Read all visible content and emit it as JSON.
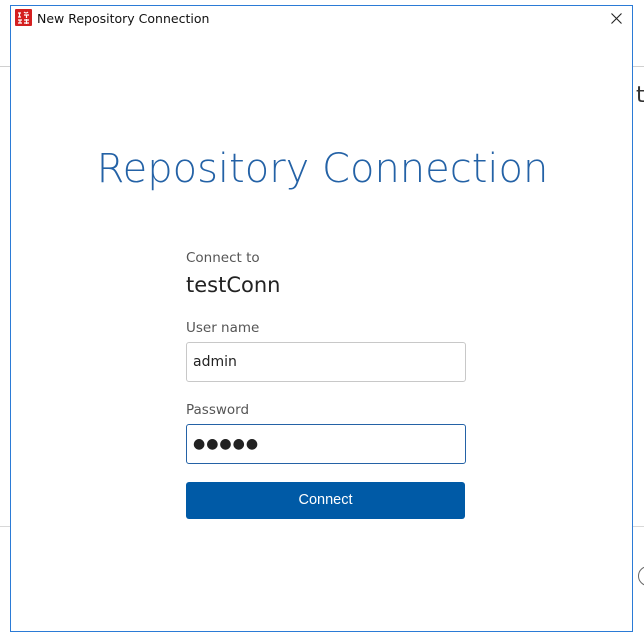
{
  "window": {
    "title": "New Repository Connection",
    "accent_color": "#2b7bd6"
  },
  "background": {
    "partial_text": "t"
  },
  "form": {
    "heading": "Repository Connection",
    "connect_to_label": "Connect to",
    "connect_to_value": "testConn",
    "username_label": "User name",
    "username_value": "admin",
    "password_label": "Password",
    "password_masked": "●●●●●",
    "connect_button_label": "Connect"
  },
  "icons": {
    "app": "app-logo-icon",
    "close": "close-icon"
  },
  "colors": {
    "heading": "#2462a6",
    "button": "#005aa6",
    "focused_border": "#2462a6"
  }
}
